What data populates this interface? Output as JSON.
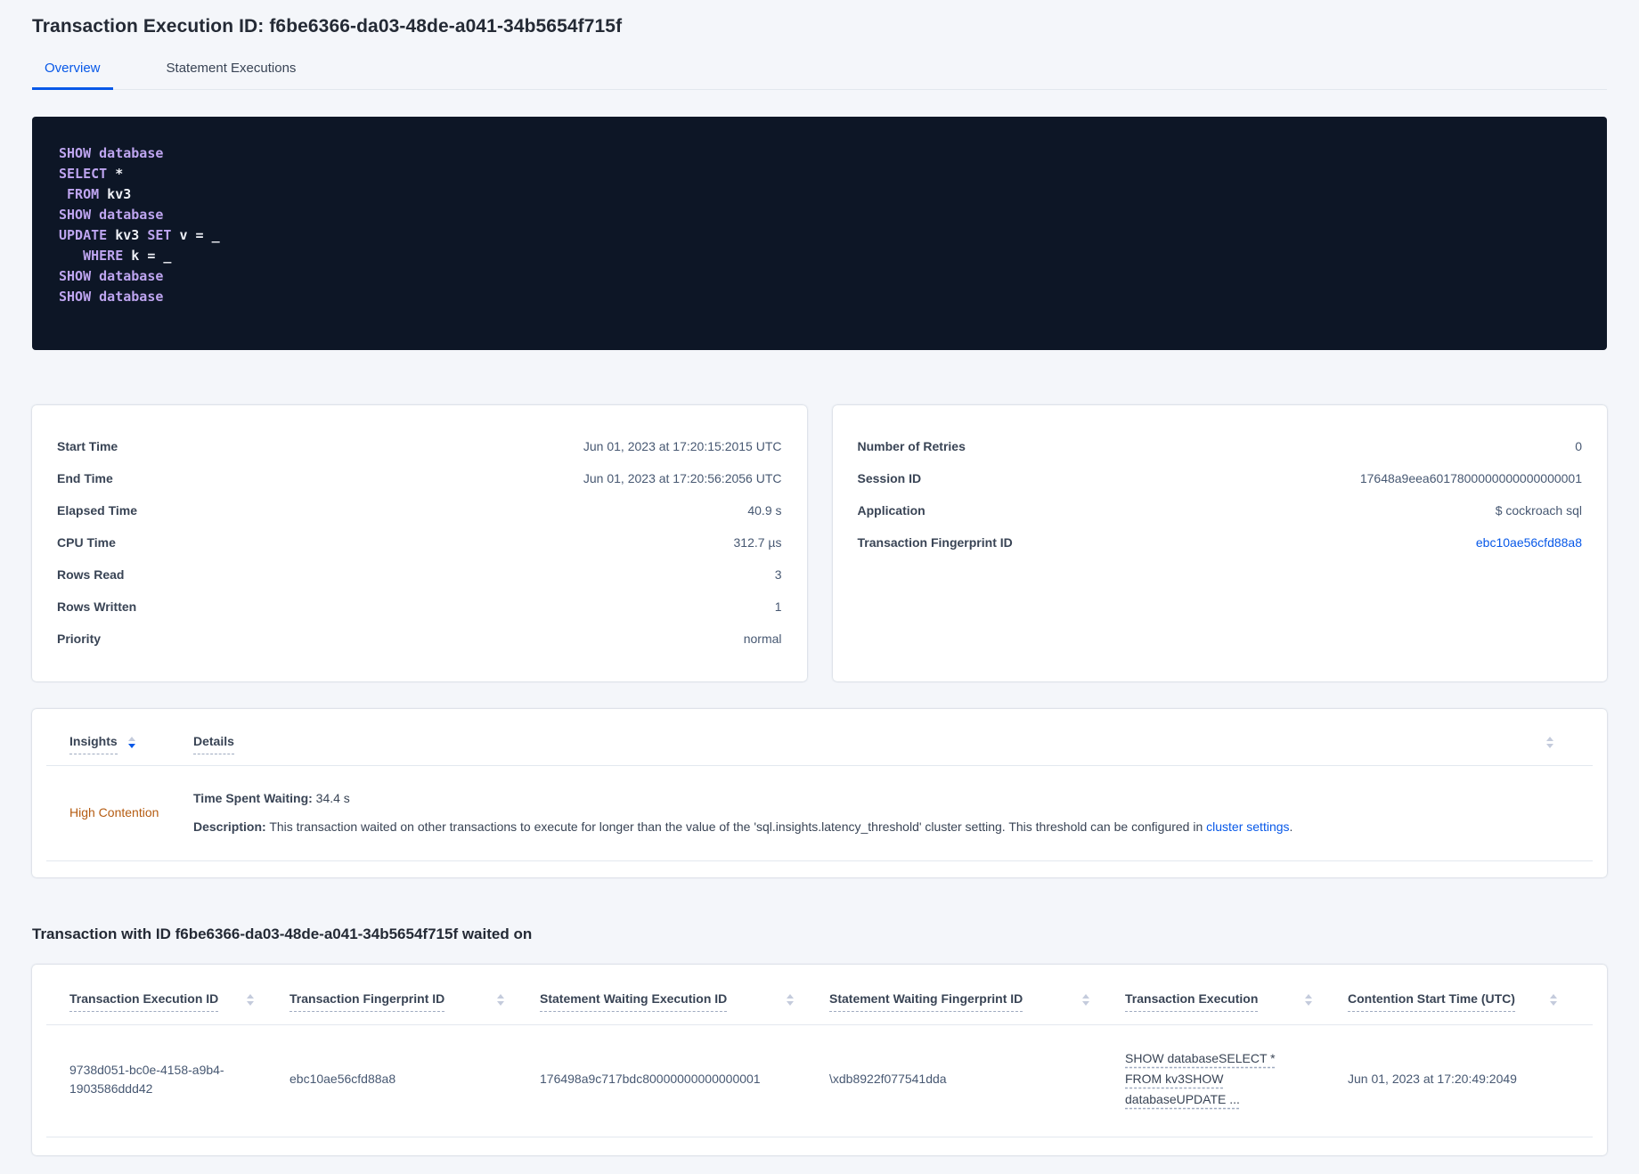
{
  "page": {
    "title": "Transaction Execution ID: f6be6366-da03-48de-a041-34b5654f715f",
    "tabs": [
      {
        "label": "Overview",
        "active": true
      },
      {
        "label": "Statement Executions",
        "active": false
      }
    ]
  },
  "colors": {
    "accent_blue": "#0758e8",
    "code_background": "#0d1626",
    "code_keyword": "#bea5f0",
    "code_plain": "#eef0f6",
    "insight_orange": "#b55c12"
  },
  "sql_box": {
    "lines": [
      [
        {
          "t": "SHOW database",
          "c": "kw"
        }
      ],
      [
        {
          "t": "SELECT",
          "c": "kw"
        },
        {
          "t": " *",
          "c": "pl"
        }
      ],
      [
        {
          "t": " ",
          "c": "pl"
        },
        {
          "t": "FROM",
          "c": "kw"
        },
        {
          "t": " kv3",
          "c": "pl"
        }
      ],
      [
        {
          "t": "SHOW database",
          "c": "kw"
        }
      ],
      [
        {
          "t": "UPDATE",
          "c": "kw"
        },
        {
          "t": " kv3 ",
          "c": "pl"
        },
        {
          "t": "SET",
          "c": "kw"
        },
        {
          "t": " v = _",
          "c": "pl"
        }
      ],
      [
        {
          "t": "   ",
          "c": "pl"
        },
        {
          "t": "WHERE",
          "c": "kw"
        },
        {
          "t": " k = _",
          "c": "pl"
        }
      ],
      [
        {
          "t": "SHOW database",
          "c": "kw"
        }
      ],
      [
        {
          "t": "SHOW database",
          "c": "kw"
        }
      ]
    ]
  },
  "summary_left": {
    "rows": [
      {
        "label": "Start Time",
        "value": "Jun 01, 2023 at 17:20:15:2015 UTC"
      },
      {
        "label": "End Time",
        "value": "Jun 01, 2023 at 17:20:56:2056 UTC"
      },
      {
        "label": "Elapsed Time",
        "value": "40.9 s"
      },
      {
        "label": "CPU Time",
        "value": "312.7 µs"
      },
      {
        "label": "Rows Read",
        "value": "3"
      },
      {
        "label": "Rows Written",
        "value": "1"
      },
      {
        "label": "Priority",
        "value": "normal"
      }
    ]
  },
  "summary_right": {
    "rows": [
      {
        "label": "Number of Retries",
        "value": "0"
      },
      {
        "label": "Session ID",
        "value": "17648a9eea6017800000000000000001"
      },
      {
        "label": "Application",
        "value": "$ cockroach sql"
      },
      {
        "label": "Transaction Fingerprint ID",
        "value": "ebc10ae56cfd88a8",
        "link": true
      }
    ]
  },
  "insights": {
    "columns": [
      "Insights",
      "Details"
    ],
    "row": {
      "insight": "High Contention",
      "waiting_label": "Time Spent Waiting:",
      "waiting_value": " 34.4 s",
      "description_label": "Description:",
      "description_text": " This transaction waited on other transactions to execute for longer than the value of the 'sql.insights.latency_threshold' cluster setting. This threshold can be configured in ",
      "description_link": "cluster settings",
      "description_suffix": "."
    }
  },
  "waited_on": {
    "heading": "Transaction with ID f6be6366-da03-48de-a041-34b5654f715f waited on",
    "columns": [
      "Transaction Execution ID",
      "Transaction Fingerprint ID",
      "Statement Waiting Execution ID",
      "Statement Waiting Fingerprint ID",
      "Transaction Execution",
      "Contention Start Time (UTC)"
    ],
    "row": {
      "txn_execution_id": "9738d051-bc0e-4158-a9b4-1903586ddd42",
      "txn_fingerprint_id": "ebc10ae56cfd88a8",
      "stmt_waiting_execution_id": "176498a9c717bdc80000000000000001",
      "stmt_waiting_fingerprint_id": "\\xdb8922f077541dda",
      "txn_execution": "SHOW databaseSELECT * FROM kv3SHOW databaseUPDATE ...",
      "contention_start": "Jun 01, 2023 at 17:20:49:2049"
    }
  }
}
